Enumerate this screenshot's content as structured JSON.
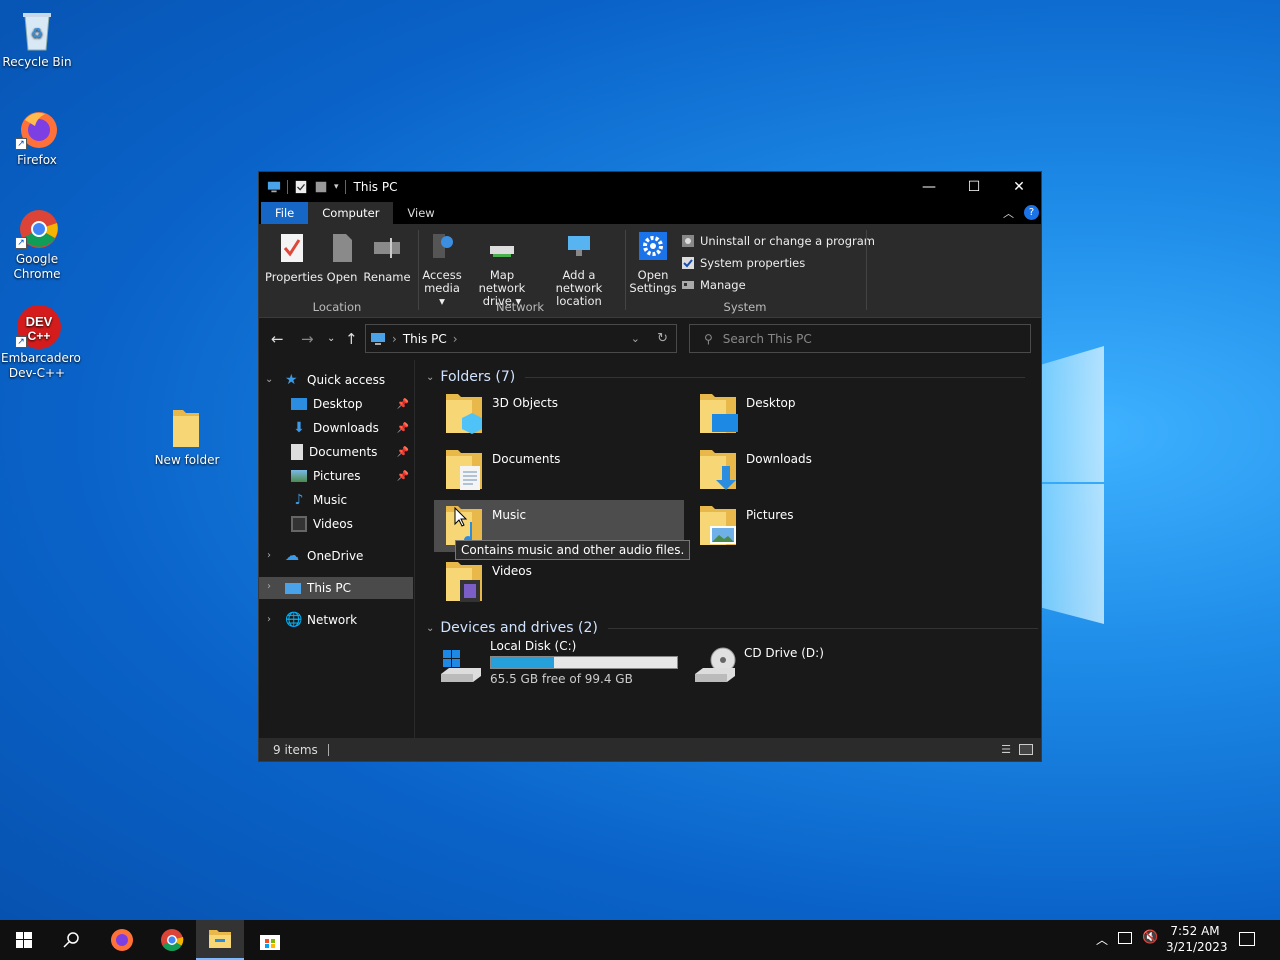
{
  "desktop": {
    "icons": [
      {
        "label": "Recycle Bin"
      },
      {
        "label": "Firefox"
      },
      {
        "label": "Google Chrome"
      },
      {
        "label": "Embarcadero Dev-C++"
      },
      {
        "label": "New folder"
      }
    ]
  },
  "window": {
    "title": "This PC",
    "controls": {
      "minimize": "—",
      "maximize": "☐",
      "close": "✕"
    },
    "tabs": [
      "File",
      "Computer",
      "View"
    ],
    "ribbon": {
      "location": {
        "label": "Location",
        "buttons": [
          "Properties",
          "Open",
          "Rename"
        ]
      },
      "network": {
        "label": "Network",
        "access_media_l1": "Access",
        "access_media_l2": "media ▾",
        "map_drive_l1": "Map network",
        "map_drive_l2": "drive ▾",
        "add_loc_l1": "Add a network",
        "add_loc_l2": "location"
      },
      "system": {
        "label": "System",
        "open_settings_l1": "Open",
        "open_settings_l2": "Settings",
        "uninstall": "Uninstall or change a program",
        "sys_props": "System properties",
        "manage": "Manage"
      }
    },
    "address": {
      "path": "This PC",
      "separator": "›"
    },
    "search": {
      "placeholder": "Search This PC"
    },
    "nav": {
      "quick_access": "Quick access",
      "quick_items": [
        "Desktop",
        "Downloads",
        "Documents",
        "Pictures",
        "Music",
        "Videos"
      ],
      "onedrive": "OneDrive",
      "this_pc": "This PC",
      "network": "Network"
    },
    "content": {
      "folders_header": "Folders (7)",
      "folders": [
        "3D Objects",
        "Desktop",
        "Documents",
        "Downloads",
        "Music",
        "Pictures",
        "Videos"
      ],
      "drives_header": "Devices and drives (2)",
      "local_disk": {
        "name": "Local Disk (C:)",
        "free": "65.5 GB free of 99.4 GB",
        "used_fraction": 0.34
      },
      "cd_drive": {
        "name": "CD Drive (D:)"
      },
      "tooltip": "Contains music and other audio files."
    },
    "status": {
      "items": "9 items"
    }
  },
  "taskbar": {
    "time": "7:52 AM",
    "date": "3/21/2023"
  }
}
